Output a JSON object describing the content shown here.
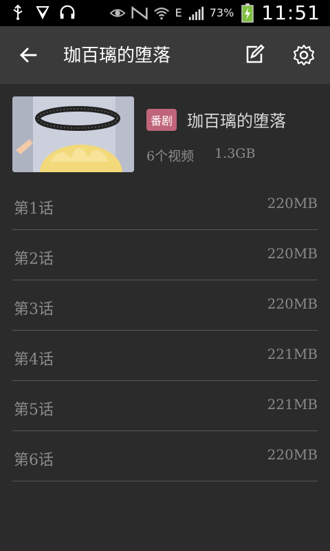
{
  "status_bar": {
    "battery_percent": "73%",
    "time": "11:51",
    "network_label": "E"
  },
  "app_bar": {
    "title": "珈百璃的堕落"
  },
  "series": {
    "badge": "番剧",
    "title": "珈百璃的堕落",
    "count": "6个视频",
    "size": "1.3GB"
  },
  "episodes": [
    {
      "name": "第1话",
      "size": "220MB"
    },
    {
      "name": "第2话",
      "size": "220MB"
    },
    {
      "name": "第3话",
      "size": "220MB"
    },
    {
      "name": "第4话",
      "size": "221MB"
    },
    {
      "name": "第5话",
      "size": "221MB"
    },
    {
      "name": "第6话",
      "size": "220MB"
    }
  ]
}
